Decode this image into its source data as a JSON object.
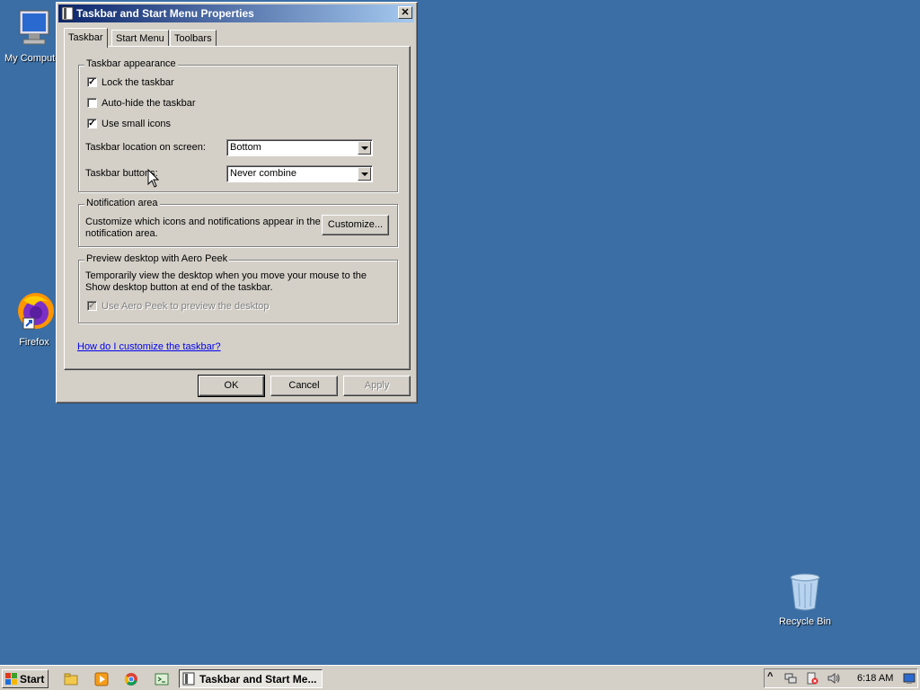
{
  "desktop": {
    "icons": [
      {
        "label": "My Computer"
      },
      {
        "label": "Firefox"
      },
      {
        "label": "Recycle Bin"
      }
    ]
  },
  "dialog": {
    "title": "Taskbar and Start Menu Properties",
    "tabs": [
      "Taskbar",
      "Start Menu",
      "Toolbars"
    ],
    "active_tab": "Taskbar",
    "appearance": {
      "title": "Taskbar appearance",
      "lock_label": "Lock the taskbar",
      "lock_checked": true,
      "autohide_label": "Auto-hide the taskbar",
      "autohide_checked": false,
      "small_icons_label": "Use small icons",
      "small_icons_checked": true,
      "location_label": "Taskbar location on screen:",
      "location_value": "Bottom",
      "buttons_label": "Taskbar buttons:",
      "buttons_value": "Never combine"
    },
    "notification": {
      "title": "Notification area",
      "desc_line1": "Customize which icons and notifications appear in the",
      "desc_line2": "notification area.",
      "customize_label": "Customize..."
    },
    "peek": {
      "title": "Preview desktop with Aero Peek",
      "desc_line1": "Temporarily view the desktop when you move your mouse to the",
      "desc_line2": "Show desktop button at end of the taskbar.",
      "peek_label": "Use Aero Peek to preview the desktop",
      "peek_checked": true,
      "peek_disabled": true
    },
    "help_link": "How do I customize the taskbar?",
    "buttons": {
      "ok": "OK",
      "cancel": "Cancel",
      "apply": "Apply"
    }
  },
  "taskbar": {
    "start_label": "Start",
    "task_button_label": "Taskbar and Start Me...",
    "clock": "6:18 AM"
  }
}
